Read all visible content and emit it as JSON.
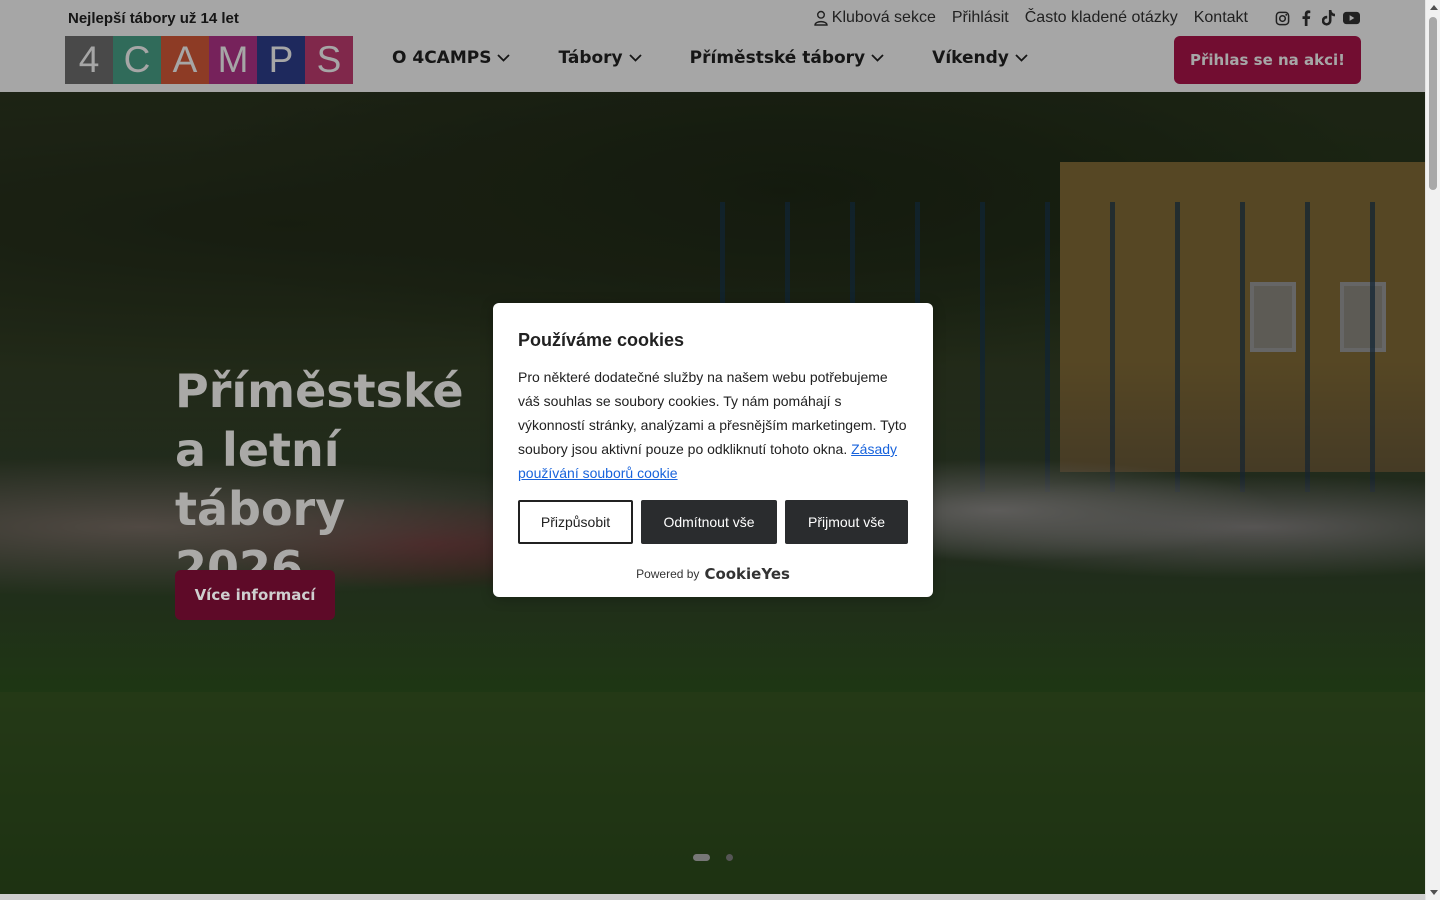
{
  "topbar": {
    "tagline_icon": "",
    "tagline": "Nejlepší tábory už 14 let",
    "links": [
      {
        "label": "Klubová sekce",
        "icon": "user-icon"
      },
      {
        "label": "Přihlásit"
      },
      {
        "label": "Často kladené otázky"
      },
      {
        "label": "Kontakt"
      }
    ],
    "socials": [
      "instagram-icon",
      "facebook-icon",
      "tiktok-icon",
      "youtube-icon"
    ]
  },
  "logo": {
    "letters": [
      "4",
      "C",
      "A",
      "M",
      "P",
      "S"
    ],
    "colors": [
      "#707070",
      "#4aa58a",
      "#d95b3a",
      "#b5358d",
      "#2f3f8f",
      "#c53e73"
    ]
  },
  "nav": {
    "items": [
      "O 4CAMPS",
      "Tábory",
      "Příměstské tábory",
      "Víkendy"
    ]
  },
  "cta": {
    "label": "Přihlas se na akci!",
    "color": "#b0144c"
  },
  "hero": {
    "title": "Příměstské\na letní tábory\n2026",
    "button": "Více informací",
    "slides": 2,
    "active_slide": 1
  },
  "cookie": {
    "title": "Používáme cookies",
    "title_icon": "",
    "text": "Pro některé dodatečné služby na našem webu potřebujeme váš souhlas se soubory cookies. Ty nám pomáhají s výkonností stránky, analýzami a přesnějším marketingem. Tyto soubory jsou aktivní pouze po odkliknutí tohoto okna.",
    "link": "Zásady používání souborů cookie",
    "buttons": {
      "customize": "Přizpůsobit",
      "reject": "Odmítnout vše",
      "accept": "Přijmout vše"
    },
    "powered_by": "Powered by",
    "brand": "CookieYes"
  }
}
